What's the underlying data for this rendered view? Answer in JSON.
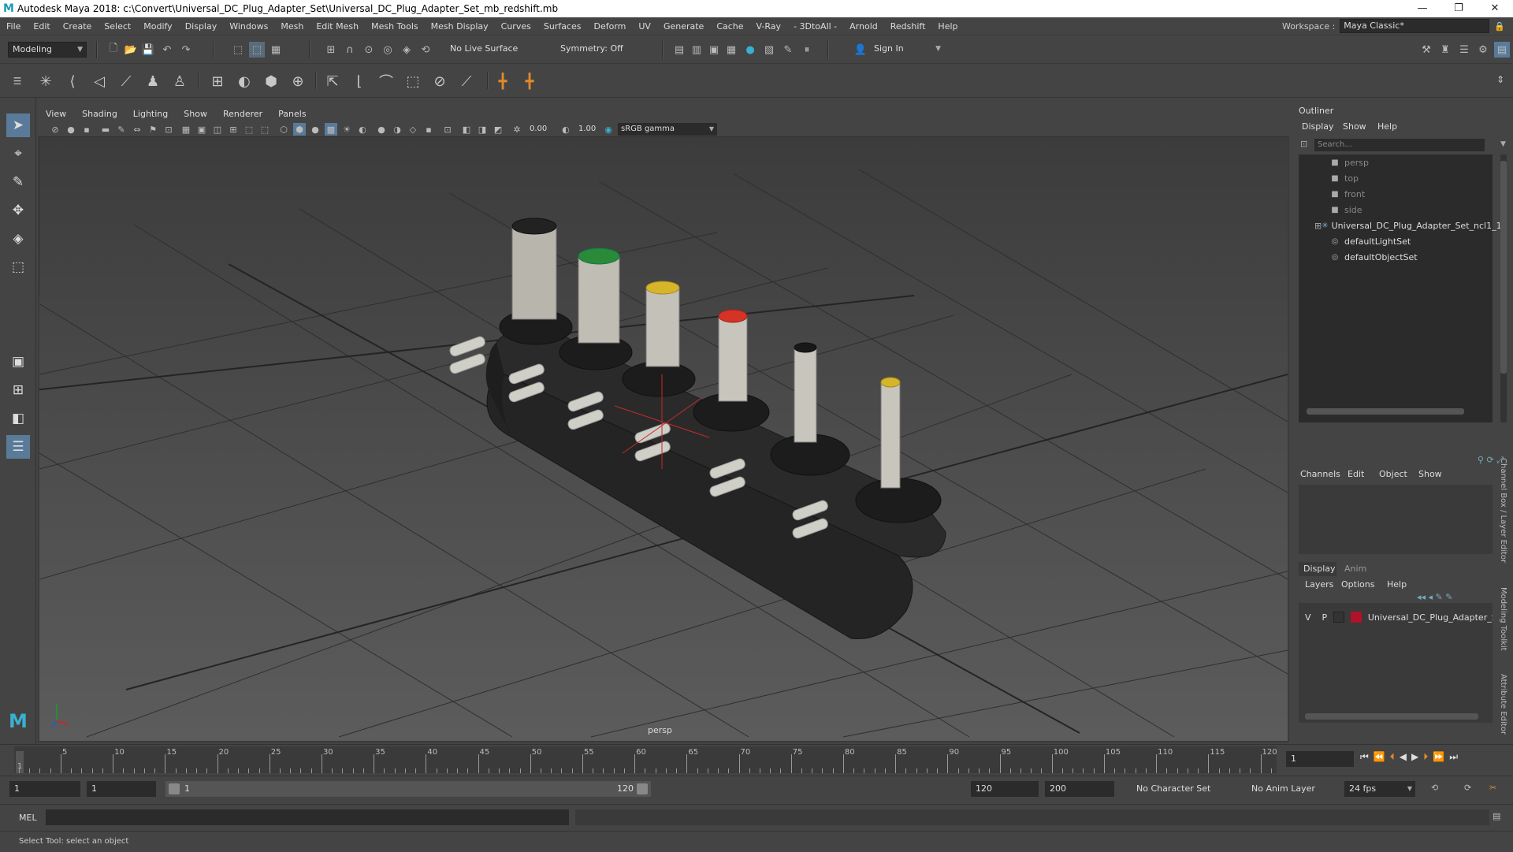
{
  "window": {
    "title": "Autodesk Maya 2018: c:\\Convert\\Universal_DC_Plug_Adapter_Set\\Universal_DC_Plug_Adapter_Set_mb_redshift.mb",
    "logo": "M"
  },
  "menubar": {
    "items": [
      "File",
      "Edit",
      "Create",
      "Select",
      "Modify",
      "Display",
      "Windows",
      "Mesh",
      "Edit Mesh",
      "Mesh Tools",
      "Mesh Display",
      "Curves",
      "Surfaces",
      "Deform",
      "UV",
      "Generate",
      "Cache",
      "V-Ray",
      "- 3DtoAll -",
      "Arnold",
      "Redshift",
      "Help"
    ],
    "workspace_label": "Workspace :",
    "workspace_value": "Maya Classic*"
  },
  "statusline": {
    "mode": "Modeling",
    "live_surface": "No Live Surface",
    "symmetry": "Symmetry: Off",
    "sign_in": "Sign In"
  },
  "viewport": {
    "menu": [
      "View",
      "Shading",
      "Lighting",
      "Show",
      "Renderer",
      "Panels"
    ],
    "exposure": "0.00",
    "gamma": "1.00",
    "color_space": "sRGB gamma",
    "camera": "persp"
  },
  "outliner": {
    "title": "Outliner",
    "menu": [
      "Display",
      "Show",
      "Help"
    ],
    "search_placeholder": "Search...",
    "items": [
      {
        "label": "persp",
        "icon": "camera-icon",
        "dim": true
      },
      {
        "label": "top",
        "icon": "camera-icon",
        "dim": true
      },
      {
        "label": "front",
        "icon": "camera-icon",
        "dim": true
      },
      {
        "label": "side",
        "icon": "camera-icon",
        "dim": true
      },
      {
        "label": "Universal_DC_Plug_Adapter_Set_ncl1_1",
        "icon": "group-icon",
        "dim": false,
        "expand": "⊞"
      },
      {
        "label": "defaultLightSet",
        "icon": "set-icon",
        "dim": false
      },
      {
        "label": "defaultObjectSet",
        "icon": "set-icon",
        "dim": false
      }
    ]
  },
  "channelbox": {
    "menu": [
      "Channels",
      "Edit",
      "Object",
      "Show"
    ],
    "tabs": [
      "Display",
      "Anim"
    ],
    "layer_menu": [
      "Layers",
      "Options",
      "Help"
    ],
    "layer": {
      "v": "V",
      "p": "P",
      "name": "Universal_DC_Plug_Adapter_Se",
      "color": "#b0122a"
    },
    "side_tabs": [
      "Channel Box / Layer Editor",
      "Modeling Toolkit",
      "Attribute Editor"
    ]
  },
  "timeline": {
    "ticks": [
      "5",
      "10",
      "15",
      "20",
      "25",
      "30",
      "35",
      "40",
      "45",
      "50",
      "55",
      "60",
      "65",
      "70",
      "75",
      "80",
      "85",
      "90",
      "95",
      "100",
      "105",
      "110",
      "115",
      "120"
    ],
    "current_marker": "1",
    "current_frame": "1"
  },
  "range": {
    "start": "1",
    "start2": "1",
    "slider_start": "1",
    "slider_end": "120",
    "end": "120",
    "end2": "200",
    "character_set": "No Character Set",
    "anim_layer": "No Anim Layer",
    "fps": "24 fps"
  },
  "command": {
    "lang": "MEL",
    "help": "Select Tool: select an object"
  }
}
